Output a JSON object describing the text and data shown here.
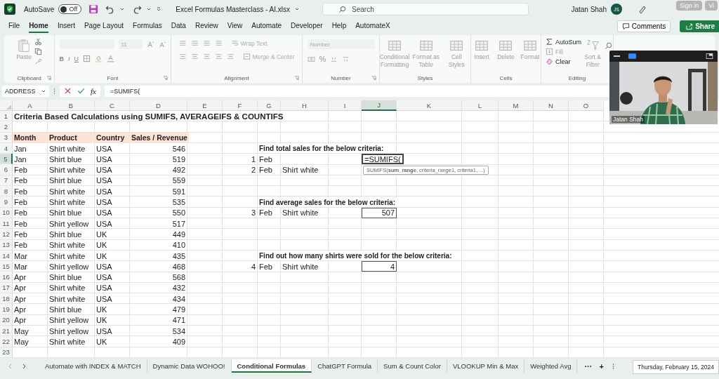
{
  "title_bar": {
    "autosave": "AutoSave",
    "toggle": {
      "label": "Off",
      "on": false
    },
    "file_name": "Excel Formulas Masterclass - AI.xlsx",
    "search": {
      "placeholder": "Search"
    },
    "user": "Jatan Shah",
    "initials": "JS",
    "overlay_buttons": [
      "Sign in",
      "Vi"
    ]
  },
  "menu": {
    "tabs": [
      {
        "label": "File",
        "selected": false
      },
      {
        "label": "Home",
        "selected": true
      },
      {
        "label": "Insert",
        "selected": false
      },
      {
        "label": "Page Layout",
        "selected": false
      },
      {
        "label": "Formulas",
        "selected": false
      },
      {
        "label": "Data",
        "selected": false
      },
      {
        "label": "Review",
        "selected": false
      },
      {
        "label": "View",
        "selected": false
      },
      {
        "label": "Automate",
        "selected": false
      },
      {
        "label": "Developer",
        "selected": false
      },
      {
        "label": "Help",
        "selected": false
      },
      {
        "label": "AutomateX",
        "selected": false
      }
    ],
    "comments": "Comments",
    "share": "Share"
  },
  "ribbon": {
    "groups": [
      {
        "kind": "clipboard",
        "label": "Clipboard",
        "paste": "Paste"
      },
      {
        "kind": "font",
        "label": "Font",
        "size": "11",
        "styles": [
          "B",
          "I",
          "U"
        ]
      },
      {
        "kind": "alignment",
        "label": "Alignment",
        "wrap": "Wrap Text",
        "merge": "Merge & Center"
      },
      {
        "kind": "number",
        "label": "Number",
        "format": "Number",
        "percent": "%"
      },
      {
        "kind": "buttons",
        "label": "Styles",
        "buttons": [
          "Conditional Formatting",
          "Format as Table",
          "Cell Styles"
        ]
      },
      {
        "kind": "buttons",
        "label": "Cells",
        "buttons": [
          "Insert",
          "Delete",
          "Format"
        ]
      },
      {
        "kind": "editing",
        "label": "Editing",
        "autosum": "AutoSum",
        "fill": "Fill",
        "clear": "Clear",
        "sort": "Sort & Filter"
      }
    ]
  },
  "formula_bar": {
    "name_box": "ADDRESS",
    "fx": "fx",
    "formula": "=SUMIFS("
  },
  "sheet": {
    "columns": [
      {
        "label": "A",
        "selected": false
      },
      {
        "label": "B",
        "selected": false
      },
      {
        "label": "C",
        "selected": false
      },
      {
        "label": "D",
        "selected": false
      },
      {
        "label": "E",
        "selected": false
      },
      {
        "label": "F",
        "selected": false
      },
      {
        "label": "G",
        "selected": false
      },
      {
        "label": "H",
        "selected": false
      },
      {
        "label": "I",
        "selected": false
      },
      {
        "label": "J",
        "selected": true
      },
      {
        "label": "K",
        "selected": false
      },
      {
        "label": "L",
        "selected": false
      },
      {
        "label": "M",
        "selected": false
      },
      {
        "label": "N",
        "selected": false
      },
      {
        "label": "O",
        "selected": false
      }
    ],
    "rows": [
      {
        "num": "1",
        "selected": false,
        "cells": [
          {
            "kind": "title",
            "text": "Criteria Based Calculations using SUMIFS, AVERAGEIFS & COUNTIFS"
          }
        ]
      },
      {
        "num": "2",
        "selected": false,
        "cells": []
      },
      {
        "num": "3",
        "selected": false,
        "cells": [
          {
            "kind": "header",
            "text": "Month"
          },
          {
            "kind": "header",
            "text": "Product"
          },
          {
            "kind": "header",
            "text": "Country"
          },
          {
            "kind": "header",
            "text": "Sales / Revenue"
          }
        ]
      },
      {
        "num": "4",
        "selected": false,
        "cells": [
          {
            "kind": "text",
            "text": "Jan"
          },
          {
            "kind": "text",
            "text": "Shirt white"
          },
          {
            "kind": "text",
            "text": "USA"
          },
          {
            "kind": "number",
            "text": "546"
          },
          "",
          "",
          {
            "kind": "heading",
            "text": "Find total sales for the below criteria:"
          }
        ]
      },
      {
        "num": "5",
        "selected": true,
        "cells": [
          {
            "kind": "text",
            "text": "Jan"
          },
          {
            "kind": "text",
            "text": "Shirt blue"
          },
          {
            "kind": "text",
            "text": "USA"
          },
          {
            "kind": "number",
            "text": "519"
          },
          "",
          {
            "kind": "number",
            "text": "1"
          },
          {
            "kind": "text",
            "text": "Feb"
          },
          "",
          "",
          {
            "kind": "editing",
            "text": "=SUMIFS(",
            "tooltip": "SUMIFS(**sum_range**, criteria_range1, criteria1, ...)"
          }
        ]
      },
      {
        "num": "6",
        "selected": false,
        "cells": [
          {
            "kind": "text",
            "text": "Feb"
          },
          {
            "kind": "text",
            "text": "Shirt white"
          },
          {
            "kind": "text",
            "text": "USA"
          },
          {
            "kind": "number",
            "text": "492"
          },
          "",
          {
            "kind": "number",
            "text": "2"
          },
          {
            "kind": "text",
            "text": "Feb"
          },
          {
            "kind": "text",
            "text": "Shirt white"
          }
        ]
      },
      {
        "num": "7",
        "selected": false,
        "cells": [
          {
            "kind": "text",
            "text": "Feb"
          },
          {
            "kind": "text",
            "text": "Shirt blue"
          },
          {
            "kind": "text",
            "text": "USA"
          },
          {
            "kind": "number",
            "text": "559"
          }
        ]
      },
      {
        "num": "8",
        "selected": false,
        "cells": [
          {
            "kind": "text",
            "text": "Feb"
          },
          {
            "kind": "text",
            "text": "Shirt white"
          },
          {
            "kind": "text",
            "text": "USA"
          },
          {
            "kind": "number",
            "text": "591"
          }
        ]
      },
      {
        "num": "9",
        "selected": false,
        "cells": [
          {
            "kind": "text",
            "text": "Feb"
          },
          {
            "kind": "text",
            "text": "Shirt white"
          },
          {
            "kind": "text",
            "text": "USA"
          },
          {
            "kind": "number",
            "text": "535"
          },
          "",
          "",
          {
            "kind": "heading",
            "text": "Find average sales for the below criteria:"
          }
        ]
      },
      {
        "num": "10",
        "selected": false,
        "cells": [
          {
            "kind": "text",
            "text": "Feb"
          },
          {
            "kind": "text",
            "text": "Shirt blue"
          },
          {
            "kind": "text",
            "text": "USA"
          },
          {
            "kind": "number",
            "text": "550"
          },
          "",
          {
            "kind": "number",
            "text": "3"
          },
          {
            "kind": "text",
            "text": "Feb"
          },
          {
            "kind": "text",
            "text": "Shirt white"
          },
          "",
          {
            "kind": "boxed",
            "text": "507"
          }
        ]
      },
      {
        "num": "11",
        "selected": false,
        "cells": [
          {
            "kind": "text",
            "text": "Feb"
          },
          {
            "kind": "text",
            "text": "Shirt yellow"
          },
          {
            "kind": "text",
            "text": "USA"
          },
          {
            "kind": "number",
            "text": "517"
          }
        ]
      },
      {
        "num": "12",
        "selected": false,
        "cells": [
          {
            "kind": "text",
            "text": "Feb"
          },
          {
            "kind": "text",
            "text": "Shirt blue"
          },
          {
            "kind": "text",
            "text": "UK"
          },
          {
            "kind": "number",
            "text": "449"
          }
        ]
      },
      {
        "num": "13",
        "selected": false,
        "cells": [
          {
            "kind": "text",
            "text": "Feb"
          },
          {
            "kind": "text",
            "text": "Shirt white"
          },
          {
            "kind": "text",
            "text": "UK"
          },
          {
            "kind": "number",
            "text": "410"
          }
        ]
      },
      {
        "num": "14",
        "selected": false,
        "cells": [
          {
            "kind": "text",
            "text": "Mar"
          },
          {
            "kind": "text",
            "text": "Shirt white"
          },
          {
            "kind": "text",
            "text": "UK"
          },
          {
            "kind": "number",
            "text": "435"
          },
          "",
          "",
          {
            "kind": "heading",
            "text": "Find out how many shirts were sold for the below criteria:"
          }
        ]
      },
      {
        "num": "15",
        "selected": false,
        "cells": [
          {
            "kind": "text",
            "text": "Mar"
          },
          {
            "kind": "text",
            "text": "Shirt yellow"
          },
          {
            "kind": "text",
            "text": "USA"
          },
          {
            "kind": "number",
            "text": "468"
          },
          "",
          {
            "kind": "number",
            "text": "4"
          },
          {
            "kind": "text",
            "text": "Feb"
          },
          {
            "kind": "text",
            "text": "Shirt white"
          },
          "",
          {
            "kind": "boxed",
            "text": "4"
          }
        ]
      },
      {
        "num": "16",
        "selected": false,
        "cells": [
          {
            "kind": "text",
            "text": "Apr"
          },
          {
            "kind": "text",
            "text": "Shirt blue"
          },
          {
            "kind": "text",
            "text": "USA"
          },
          {
            "kind": "number",
            "text": "568"
          }
        ]
      },
      {
        "num": "17",
        "selected": false,
        "cells": [
          {
            "kind": "text",
            "text": "Apr"
          },
          {
            "kind": "text",
            "text": "Shirt white"
          },
          {
            "kind": "text",
            "text": "USA"
          },
          {
            "kind": "number",
            "text": "432"
          }
        ]
      },
      {
        "num": "18",
        "selected": false,
        "cells": [
          {
            "kind": "text",
            "text": "Apr"
          },
          {
            "kind": "text",
            "text": "Shirt white"
          },
          {
            "kind": "text",
            "text": "USA"
          },
          {
            "kind": "number",
            "text": "434"
          }
        ]
      },
      {
        "num": "19",
        "selected": false,
        "cells": [
          {
            "kind": "text",
            "text": "Apr"
          },
          {
            "kind": "text",
            "text": "Shirt blue"
          },
          {
            "kind": "text",
            "text": "UK"
          },
          {
            "kind": "number",
            "text": "479"
          }
        ]
      },
      {
        "num": "20",
        "selected": false,
        "cells": [
          {
            "kind": "text",
            "text": "Apr"
          },
          {
            "kind": "text",
            "text": "Shirt yellow"
          },
          {
            "kind": "text",
            "text": "UK"
          },
          {
            "kind": "number",
            "text": "471"
          }
        ]
      },
      {
        "num": "21",
        "selected": false,
        "cells": [
          {
            "kind": "text",
            "text": "May"
          },
          {
            "kind": "text",
            "text": "Shirt yellow"
          },
          {
            "kind": "text",
            "text": "USA"
          },
          {
            "kind": "number",
            "text": "534"
          }
        ]
      },
      {
        "num": "22",
        "selected": false,
        "cells": [
          {
            "kind": "text",
            "text": "May"
          },
          {
            "kind": "text",
            "text": "Shirt white"
          },
          {
            "kind": "text",
            "text": "UK"
          },
          {
            "kind": "number",
            "text": "409"
          }
        ]
      },
      {
        "num": "23",
        "selected": false,
        "cells": []
      }
    ]
  },
  "sheet_tabs": [
    {
      "label": "Automate with INDEX & MATCH",
      "selected": false
    },
    {
      "label": "Dynamic Data WOHOO!",
      "selected": false
    },
    {
      "label": "Conditional Formulas",
      "selected": true
    },
    {
      "label": "ChatGPT Formula",
      "selected": false
    },
    {
      "label": "Sum & Count Color",
      "selected": false
    },
    {
      "label": "VLOOKUP Min & Max",
      "selected": false
    },
    {
      "label": "Weighted Avg",
      "selected": false
    }
  ],
  "tab_controls": [
    "···",
    "+"
  ],
  "date": "Thursday, February 15, 2024",
  "video": {
    "kind": "picture",
    "name": "Jatan Shah"
  }
}
